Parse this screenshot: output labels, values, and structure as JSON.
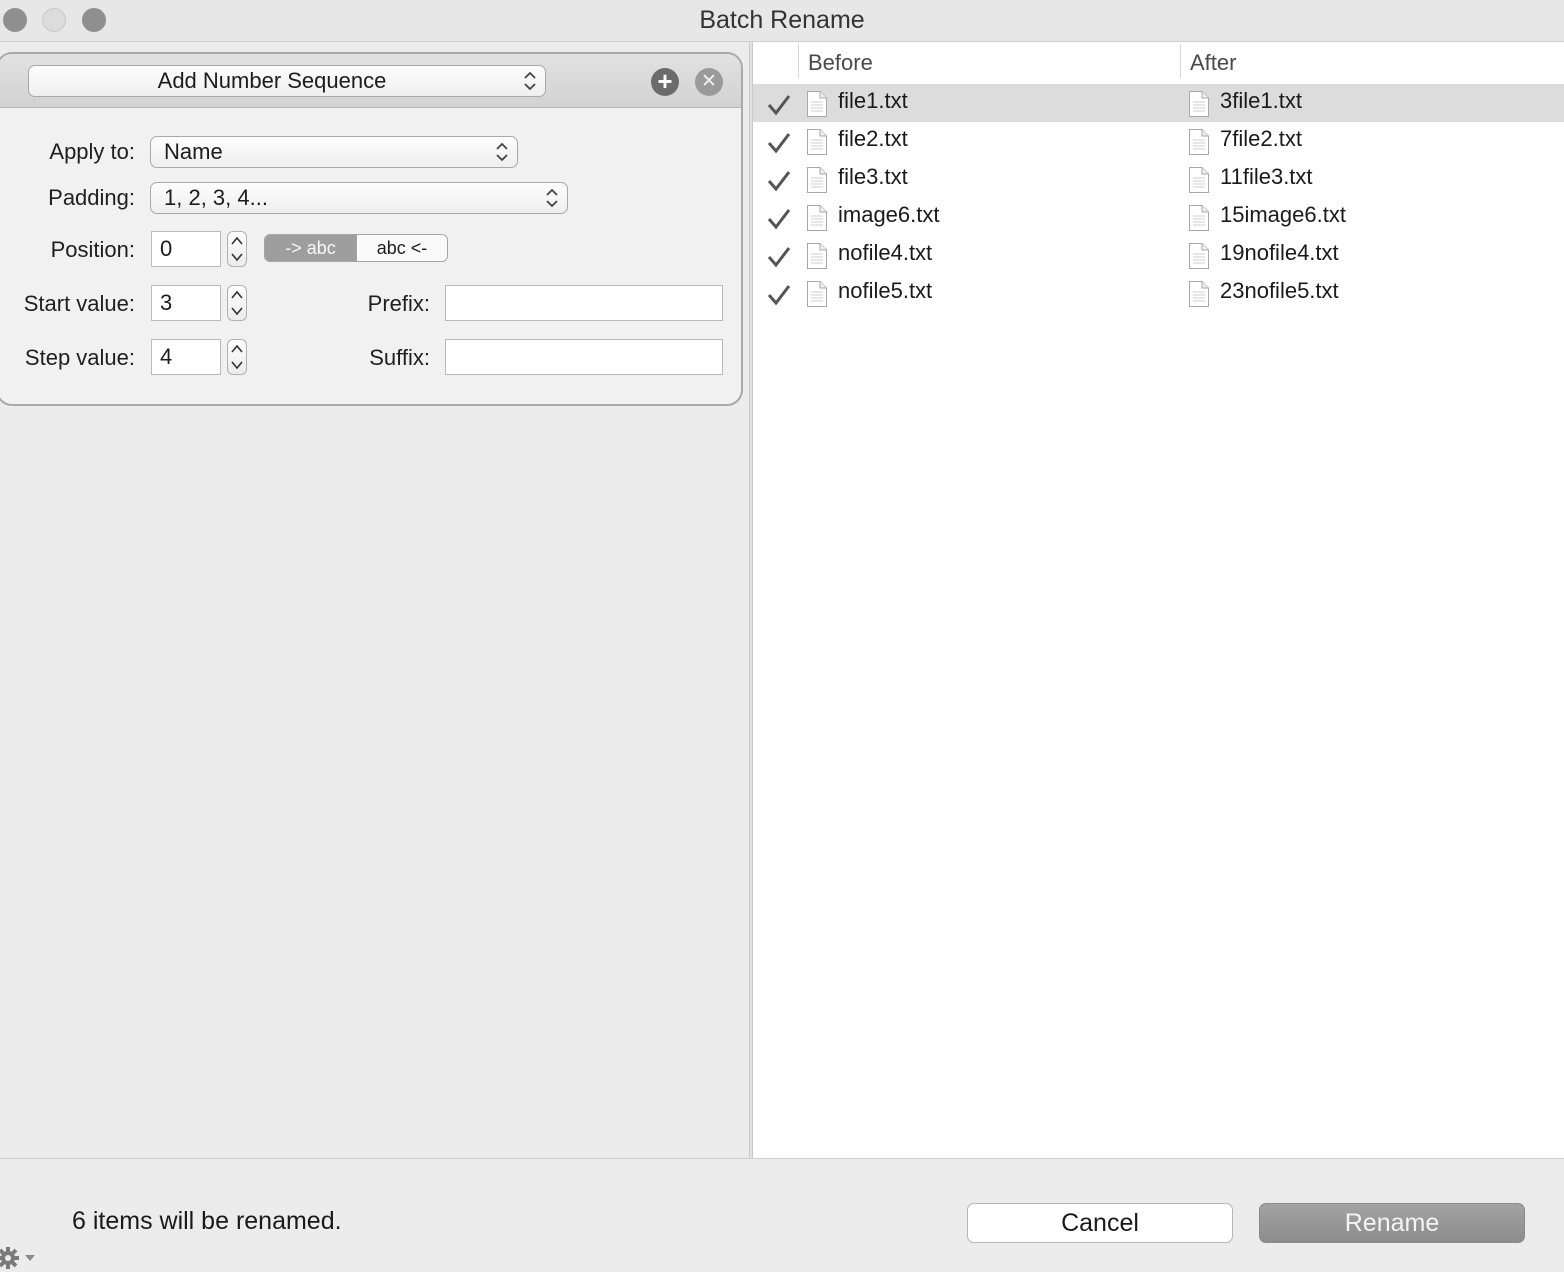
{
  "window": {
    "title": "Batch Rename"
  },
  "operation": {
    "type_label": "Add Number Sequence",
    "apply_to_label": "Apply to:",
    "apply_to_value": "Name",
    "padding_label": "Padding:",
    "padding_value": "1, 2, 3, 4...",
    "position_label": "Position:",
    "position_value": "0",
    "direction_left": "-> abc",
    "direction_right": "abc <-",
    "start_label": "Start value:",
    "start_value": "3",
    "step_label": "Step value:",
    "step_value": "4",
    "prefix_label": "Prefix:",
    "prefix_value": "",
    "suffix_label": "Suffix:",
    "suffix_value": ""
  },
  "table": {
    "headers": {
      "before": "Before",
      "after": "After"
    },
    "rows": [
      {
        "before": "file1.txt",
        "after": "3file1.txt",
        "checked": true,
        "selected": true
      },
      {
        "before": "file2.txt",
        "after": "7file2.txt",
        "checked": true,
        "selected": false
      },
      {
        "before": "file3.txt",
        "after": "11file3.txt",
        "checked": true,
        "selected": false
      },
      {
        "before": "image6.txt",
        "after": "15image6.txt",
        "checked": true,
        "selected": false
      },
      {
        "before": "nofile4.txt",
        "after": "19nofile4.txt",
        "checked": true,
        "selected": false
      },
      {
        "before": "nofile5.txt",
        "after": "23nofile5.txt",
        "checked": true,
        "selected": false
      }
    ]
  },
  "footer": {
    "status": "6 items will be renamed.",
    "cancel_label": "Cancel",
    "rename_label": "Rename"
  },
  "icons": {
    "check": "checkmark-icon",
    "file": "document-icon",
    "gear": "gear-icon",
    "add": "plus-icon",
    "remove": "close-icon"
  }
}
